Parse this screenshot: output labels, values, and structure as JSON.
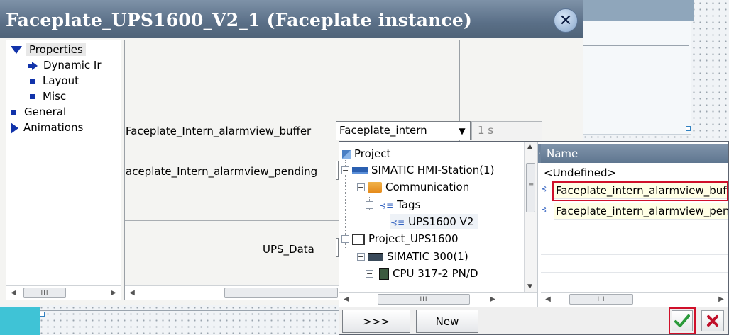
{
  "dialog": {
    "title": "Faceplate_UPS1600_V2_1 (Faceplate instance)",
    "close_icon": "close-icon"
  },
  "tree": {
    "items": [
      {
        "label": "Properties",
        "icon": "triangle-down-icon"
      },
      {
        "label": "Dynamic Ir",
        "icon": "arrow-right-icon"
      },
      {
        "label": "Layout",
        "icon": "square-bullet-icon"
      },
      {
        "label": "Misc",
        "icon": "square-bullet-icon"
      },
      {
        "label": "General",
        "icon": "square-bullet-icon"
      },
      {
        "label": "Animations",
        "icon": "triangle-right-icon"
      }
    ],
    "scroll_thumb": "III"
  },
  "properties": {
    "row1_label": "Faceplate_Intern_alarmview_buffer",
    "row1_value": "Faceplate_intern",
    "row1_time": "1 s",
    "row2_label": "aceplate_Intern_alarmview_pending",
    "row3_label": "UPS_Data"
  },
  "popup": {
    "tree": [
      {
        "label": "Project"
      },
      {
        "label": "SIMATIC HMI-Station(1)"
      },
      {
        "label": "Communication"
      },
      {
        "label": "Tags"
      },
      {
        "label": "UPS1600 V2"
      },
      {
        "label": "Project_UPS1600"
      },
      {
        "label": "SIMATIC 300(1)"
      },
      {
        "label": "CPU 317-2 PN/D"
      }
    ],
    "list_header": "Name",
    "list_header_stub": "..",
    "list_rows": [
      {
        "label": "<Undefined>"
      },
      {
        "label": "Faceplate_intern_alarmview_buffer"
      },
      {
        "label": "Faceplate_intern_alarmview_pending"
      }
    ],
    "scroll_thumb": "III",
    "buttons": {
      "expand": ">>>",
      "new": "New"
    },
    "confirm_icon": "checkmark-icon",
    "cancel_icon": "cross-icon"
  },
  "colors": {
    "titlebar": "#5a6f87",
    "accent_blue": "#1133aa",
    "highlight_red": "#d0102a",
    "canvas_cyan": "#3fc3d6"
  }
}
